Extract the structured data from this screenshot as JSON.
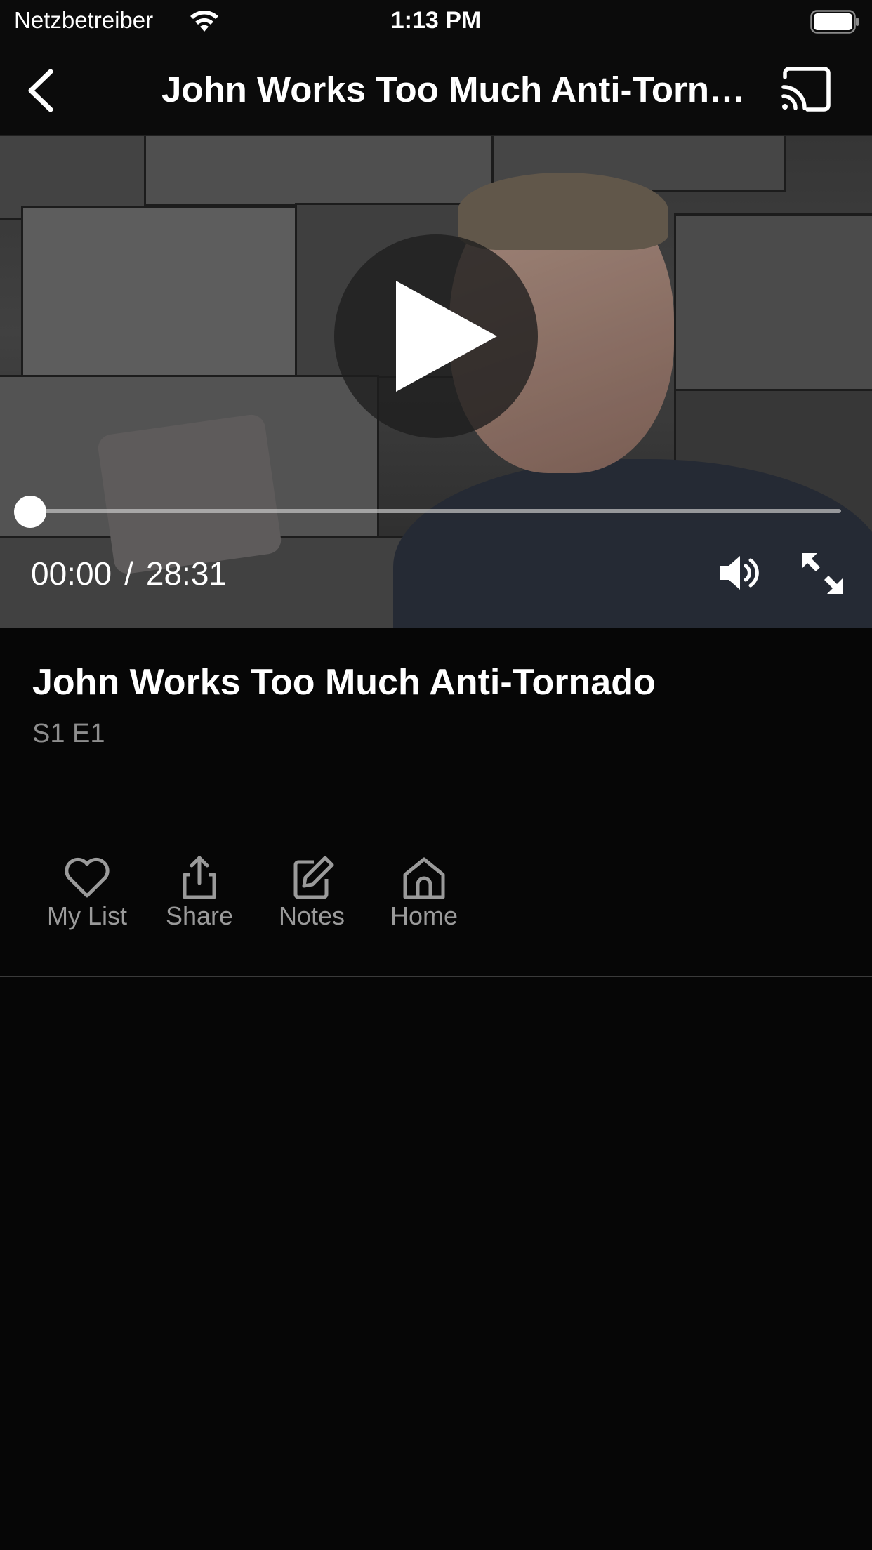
{
  "status_bar": {
    "carrier": "Netzbetreiber",
    "time": "1:13 PM"
  },
  "nav": {
    "title": "John Works Too Much  Anti-Tornado",
    "back_icon": "chevron-left-icon",
    "cast_icon": "cast-icon"
  },
  "player": {
    "current_time": "00:00",
    "separator": "/",
    "duration": "28:31",
    "progress": 0,
    "play_icon": "play-icon",
    "volume_icon": "volume-icon",
    "fullscreen_icon": "fullscreen-icon"
  },
  "episode": {
    "title": "John Works Too Much  Anti-Tornado",
    "meta": "S1 E1"
  },
  "actions": [
    {
      "label": "My List",
      "icon": "heart-icon"
    },
    {
      "label": "Share",
      "icon": "share-icon"
    },
    {
      "label": "Notes",
      "icon": "edit-icon"
    },
    {
      "label": "Home",
      "icon": "home-icon"
    }
  ],
  "colors": {
    "background": "#060606",
    "bar_background": "#0b0b0b",
    "secondary_text": "#8d8d8d",
    "action_text": "#9a9a9a"
  }
}
